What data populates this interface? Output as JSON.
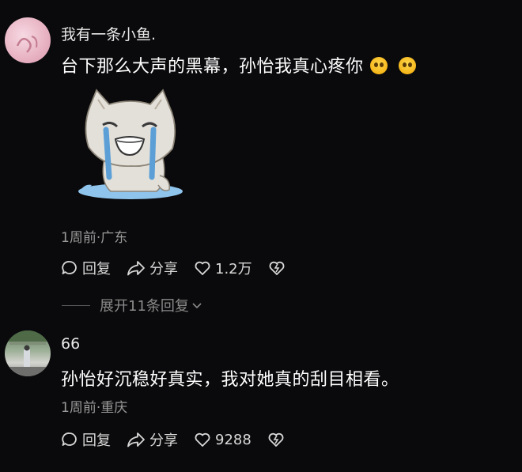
{
  "comments": [
    {
      "username": "我有一条小鱼.",
      "text": "台下那么大声的黑幕，孙怡我真心疼你",
      "meta": "1周前·广东",
      "reply_label": "回复",
      "share_label": "分享",
      "like_count": "1.2万",
      "expand_replies": "展开11条回复"
    },
    {
      "username": "66",
      "text": "孙怡好沉稳好真实，我对她真的刮目相看。",
      "meta": "1周前·重庆",
      "reply_label": "回复",
      "share_label": "分享",
      "like_count": "9288"
    }
  ],
  "icons": {
    "reply": "comment-bubble-icon",
    "share": "share-arrow-icon",
    "like": "heart-icon",
    "dislike": "broken-heart-icon",
    "expand": "chevron-down-icon",
    "emoji": "pleading-face-emoji"
  },
  "colors": {
    "background": "#0a0a0c",
    "meta_text": "#9a9a9a",
    "primary_text": "#ffffff"
  }
}
